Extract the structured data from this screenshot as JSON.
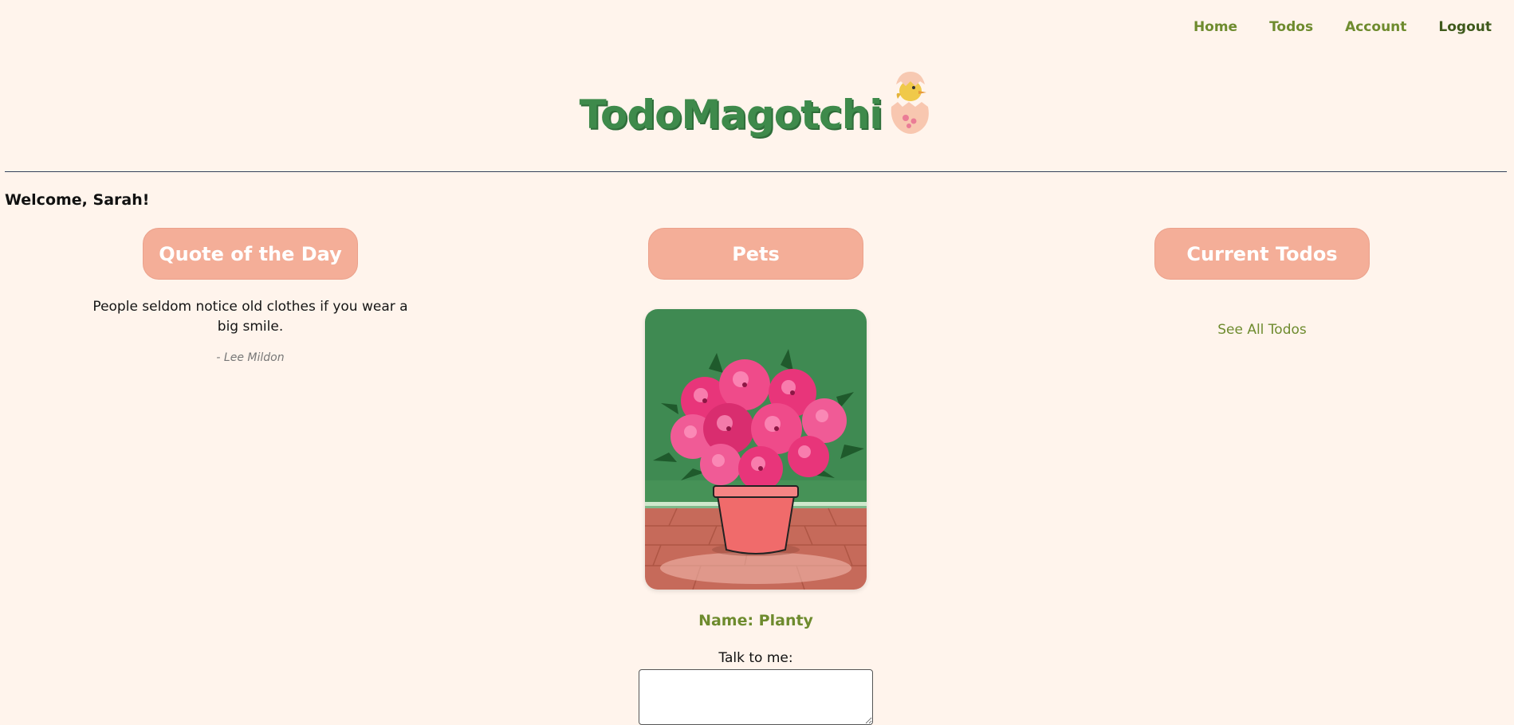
{
  "nav": {
    "items": [
      "Home",
      "Todos",
      "Account",
      "Logout"
    ]
  },
  "logo": {
    "text": "TodoMagotchi",
    "icon": "egg-chick-icon"
  },
  "welcome": "Welcome, Sarah!",
  "quote": {
    "header": "Quote of the Day",
    "text": "People seldom notice old clothes if you wear a big smile.",
    "author": "- Lee Mildon"
  },
  "pets": {
    "header": "Pets",
    "image": "potted-pink-azalea-plant",
    "name_label": "Name: Planty",
    "talk_label": "Talk to me:",
    "talk_value": ""
  },
  "todos": {
    "header": "Current Todos",
    "see_all": "See All Todos"
  },
  "colors": {
    "background": "#fff4ec",
    "accent_green": "#6e8b2e",
    "header_pink": "#f4ae98",
    "logo_green": "#3e8a4b"
  }
}
